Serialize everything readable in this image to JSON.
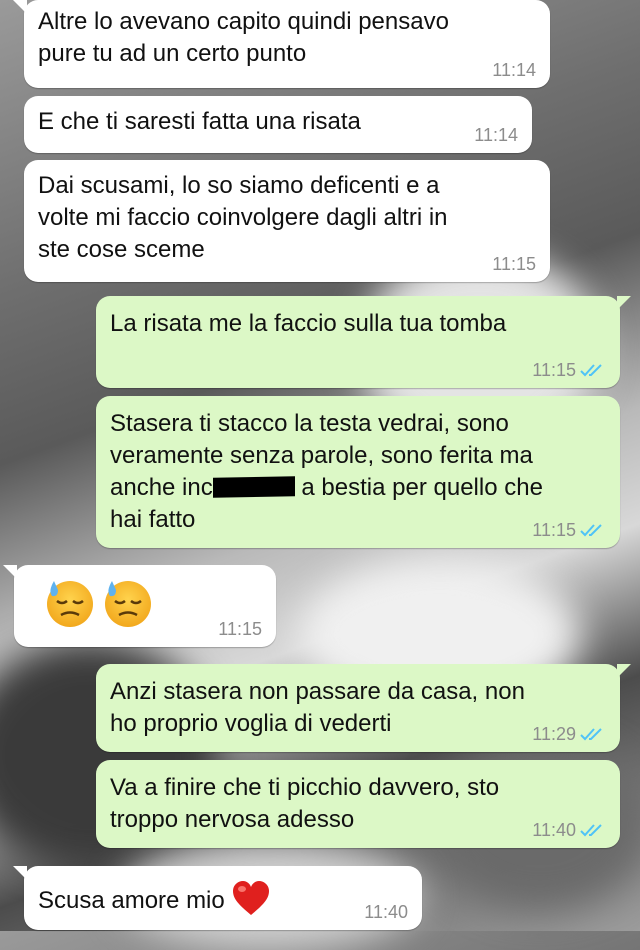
{
  "messages": [
    {
      "id": 1,
      "direction": "incoming",
      "text": "Altre lo avevano capito quindi pensavo\npure tu ad un certo punto",
      "time": "11:14"
    },
    {
      "id": 2,
      "direction": "incoming",
      "text": "E che ti saresti fatta una risata",
      "time": "11:14"
    },
    {
      "id": 3,
      "direction": "incoming",
      "text": "Dai scusami, lo so siamo deficenti e a\nvolte mi faccio coinvolgere dagli altri in\nste cose sceme",
      "time": "11:15"
    },
    {
      "id": 4,
      "direction": "outgoing",
      "text": "La risata me la faccio sulla tua tomba",
      "time": "11:15",
      "status": "read-double-check"
    },
    {
      "id": 5,
      "direction": "outgoing",
      "text_part1": "Stasera ti stacco la testa vedrai, sono\nveramente senza parole, sono ferita ma\nanche inc",
      "text_part2": " a bestia per quello che\nhai fatto",
      "redacted": true,
      "time": "11:15",
      "status": "read-double-check"
    },
    {
      "id": 6,
      "direction": "incoming",
      "emoji": [
        "downcast-sweat-face-emoji",
        "downcast-sweat-face-emoji"
      ],
      "time": "11:15"
    },
    {
      "id": 7,
      "direction": "outgoing",
      "text": "Anzi stasera non passare da casa, non\nho proprio voglia di vederti",
      "time": "11:29",
      "status": "read-double-check"
    },
    {
      "id": 8,
      "direction": "outgoing",
      "text": "Va a finire che ti picchio davvero, sto\ntroppo nervosa adesso",
      "time": "11:40",
      "status": "read-double-check"
    },
    {
      "id": 9,
      "direction": "incoming",
      "text": "Scusa amore mio",
      "emoji": [
        "red-heart-emoji"
      ],
      "time": "11:40"
    }
  ],
  "colors": {
    "incoming_bubble": "#ffffff",
    "outgoing_bubble": "#dcf8c6",
    "read_ticks": "#4fc3f7",
    "timestamp": "#8c8c8c"
  }
}
